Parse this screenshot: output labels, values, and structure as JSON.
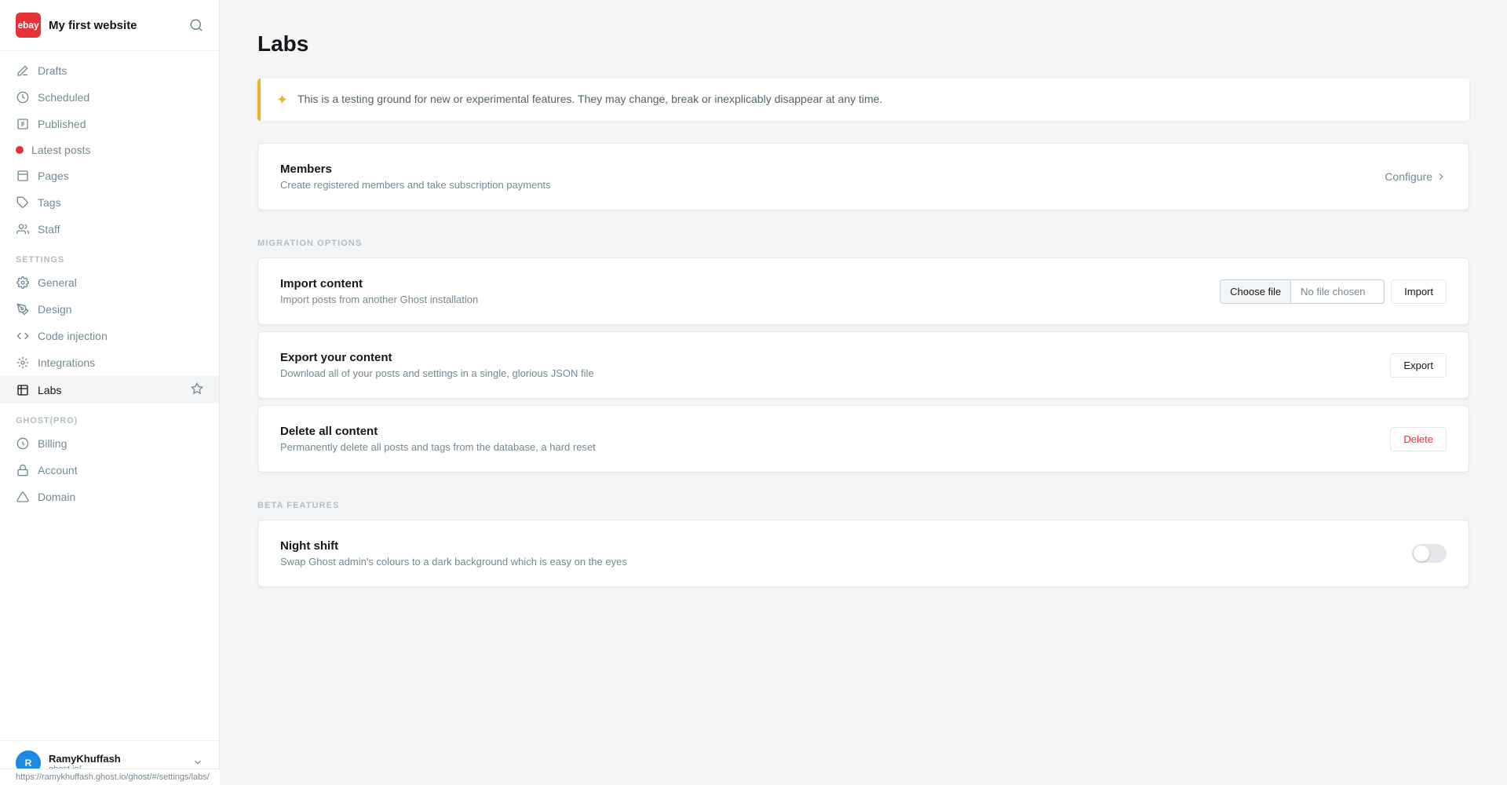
{
  "site": {
    "logo_text": "ebay",
    "title": "My first website"
  },
  "sidebar": {
    "nav_items": [
      {
        "id": "drafts",
        "label": "Drafts",
        "icon": "drafts"
      },
      {
        "id": "scheduled",
        "label": "Scheduled",
        "icon": "clock"
      },
      {
        "id": "published",
        "label": "Published",
        "icon": "published"
      },
      {
        "id": "latest-posts",
        "label": "Latest posts",
        "icon": "dot-red"
      },
      {
        "id": "pages",
        "label": "Pages",
        "icon": "pages"
      },
      {
        "id": "tags",
        "label": "Tags",
        "icon": "tag"
      },
      {
        "id": "staff",
        "label": "Staff",
        "icon": "staff"
      }
    ],
    "settings_label": "SETTINGS",
    "settings_items": [
      {
        "id": "general",
        "label": "General",
        "icon": "gear"
      },
      {
        "id": "design",
        "label": "Design",
        "icon": "design"
      },
      {
        "id": "code-injection",
        "label": "Code injection",
        "icon": "code"
      },
      {
        "id": "integrations",
        "label": "Integrations",
        "icon": "integrations"
      },
      {
        "id": "labs",
        "label": "Labs",
        "icon": "labs",
        "active": true
      }
    ],
    "ghost_pro_label": "GHOST(PRO)",
    "ghost_pro_items": [
      {
        "id": "billing",
        "label": "Billing",
        "icon": "billing"
      },
      {
        "id": "account",
        "label": "Account",
        "icon": "account"
      },
      {
        "id": "domain",
        "label": "Domain",
        "icon": "domain"
      }
    ],
    "user": {
      "name": "RamyKhuffash",
      "url": "ghost.io/..."
    }
  },
  "page": {
    "title": "Labs",
    "info_banner": "This is a testing ground for new or experimental features. They may change, break or inexplicably disappear at any time."
  },
  "members_card": {
    "title": "Members",
    "description": "Create registered members and take subscription payments",
    "action_label": "Configure"
  },
  "migration": {
    "section_label": "MIGRATION OPTIONS",
    "import": {
      "title": "Import content",
      "description": "Import posts from another Ghost installation",
      "choose_file_label": "Choose file",
      "no_file_label": "No file chosen",
      "button_label": "Import"
    },
    "export": {
      "title": "Export your content",
      "description": "Download all of your posts and settings in a single, glorious JSON file",
      "button_label": "Export"
    },
    "delete": {
      "title": "Delete all content",
      "description": "Permanently delete all posts and tags from the database, a hard reset",
      "button_label": "Delete"
    }
  },
  "beta_features": {
    "section_label": "BETA FEATURES",
    "night_shift": {
      "title": "Night shift",
      "description": "Swap Ghost admin's colours to a dark background which is easy on the eyes",
      "enabled": false
    }
  },
  "status_bar": {
    "url": "https://ramykhuffash.ghost.io/ghost/#/settings/labs/"
  }
}
